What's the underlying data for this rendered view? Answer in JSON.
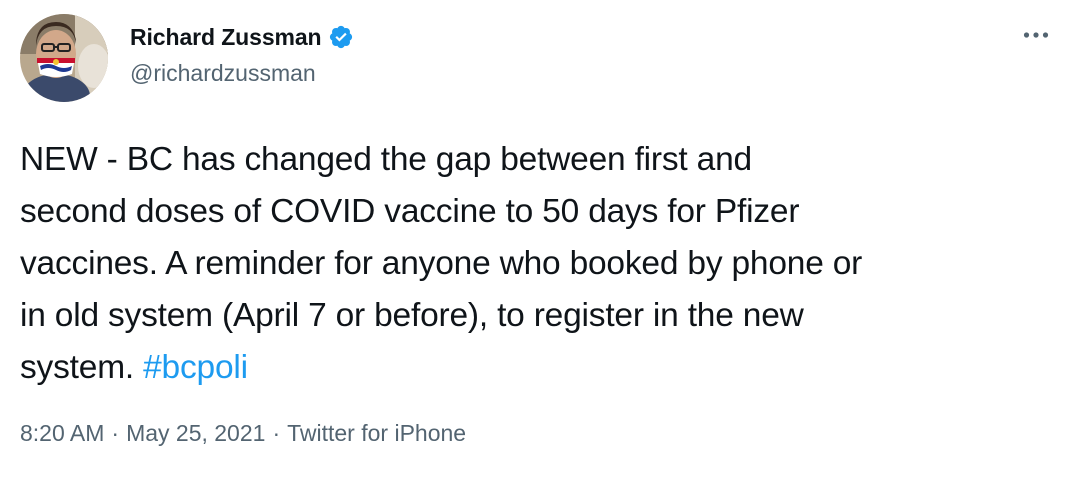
{
  "author": {
    "display_name": "Richard Zussman",
    "handle": "@richardzussman",
    "verified": true,
    "verified_icon": "verified-badge-icon",
    "avatar_icon": "profile-photo-avatar"
  },
  "tweet": {
    "text": "NEW - BC has changed the gap between first and\nsecond doses of COVID vaccine to 50 days for Pfizer\nvaccines. A reminder for anyone who booked by phone or\nin old system (April 7 or before), to register in the new\nsystem. ",
    "hashtag": "#bcpoli"
  },
  "meta": {
    "time": "8:20 AM",
    "separator": "·",
    "date": "May 25, 2021",
    "source": "Twitter for iPhone"
  },
  "menu": {
    "icon": "more-options-icon"
  },
  "colors": {
    "link": "#1d9bf0",
    "secondary_text": "#536471",
    "primary_text": "#0f1419",
    "verified": "#1d9bf0"
  }
}
